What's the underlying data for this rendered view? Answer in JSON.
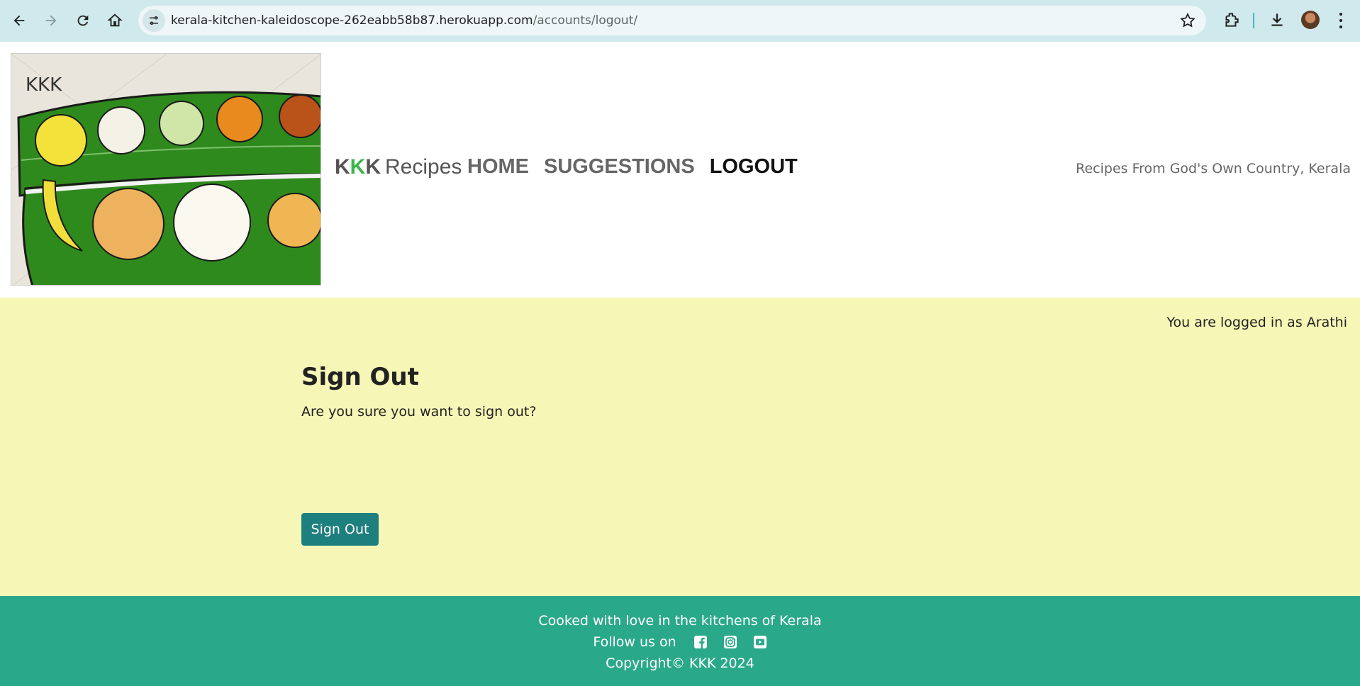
{
  "browser": {
    "url_host": "kerala-kitchen-kaleidoscope-262eabb58b87.herokuapp.com",
    "url_path": "/accounts/logout/"
  },
  "header": {
    "logo_text": "KKK",
    "brand": {
      "k1": "K",
      "k2": "K",
      "k3": "K",
      "rest": "Recipes"
    },
    "nav": [
      {
        "label": "HOME"
      },
      {
        "label": "SUGGESTIONS"
      },
      {
        "label": "LOGOUT"
      }
    ],
    "tagline": "Recipes From God's Own Country, Kerala"
  },
  "main": {
    "login_status": "You are logged in as Arathi",
    "title": "Sign Out",
    "question": "Are you sure you want to sign out?",
    "button_label": "Sign Out"
  },
  "footer": {
    "line1": "Cooked with love in the kitchens of Kerala",
    "follow_label": "Follow us on",
    "social": [
      "facebook-icon",
      "instagram-icon",
      "youtube-icon"
    ],
    "copyright": "Copyright© KKK 2024"
  },
  "colors": {
    "chrome": "#cfe9ec",
    "main_bg": "#f6f6b7",
    "footer_bg": "#2aa98a",
    "button_bg": "#1e7f7f",
    "brand_green": "#3cb54a"
  }
}
